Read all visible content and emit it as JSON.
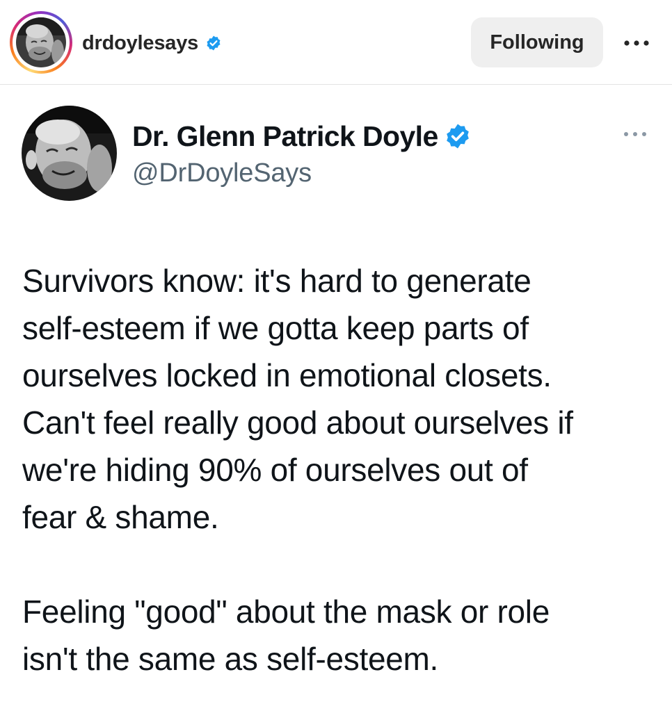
{
  "instagram_header": {
    "username": "drdoylesays",
    "verified": true,
    "follow_button_label": "Following",
    "more_icon": "more-horizontal-icon"
  },
  "tweet": {
    "display_name": "Dr. Glenn Patrick Doyle",
    "handle": "@DrDoyleSays",
    "verified": true,
    "more_icon": "more-horizontal-icon",
    "paragraphs": [
      "Survivors know: it's hard to generate\nself-esteem if we gotta keep parts of\nourselves locked in emotional closets.\nCan't feel really good about ourselves if\nwe're hiding 90% of ourselves out of\nfear & shame.",
      "Feeling \"good\" about the mask or role\nisn't the same as self-esteem."
    ]
  },
  "colors": {
    "verified_blue": "#1d9bf0",
    "follow_button_bg": "#efefef",
    "handle_gray": "#536471",
    "divider": "#e3e3e3"
  }
}
